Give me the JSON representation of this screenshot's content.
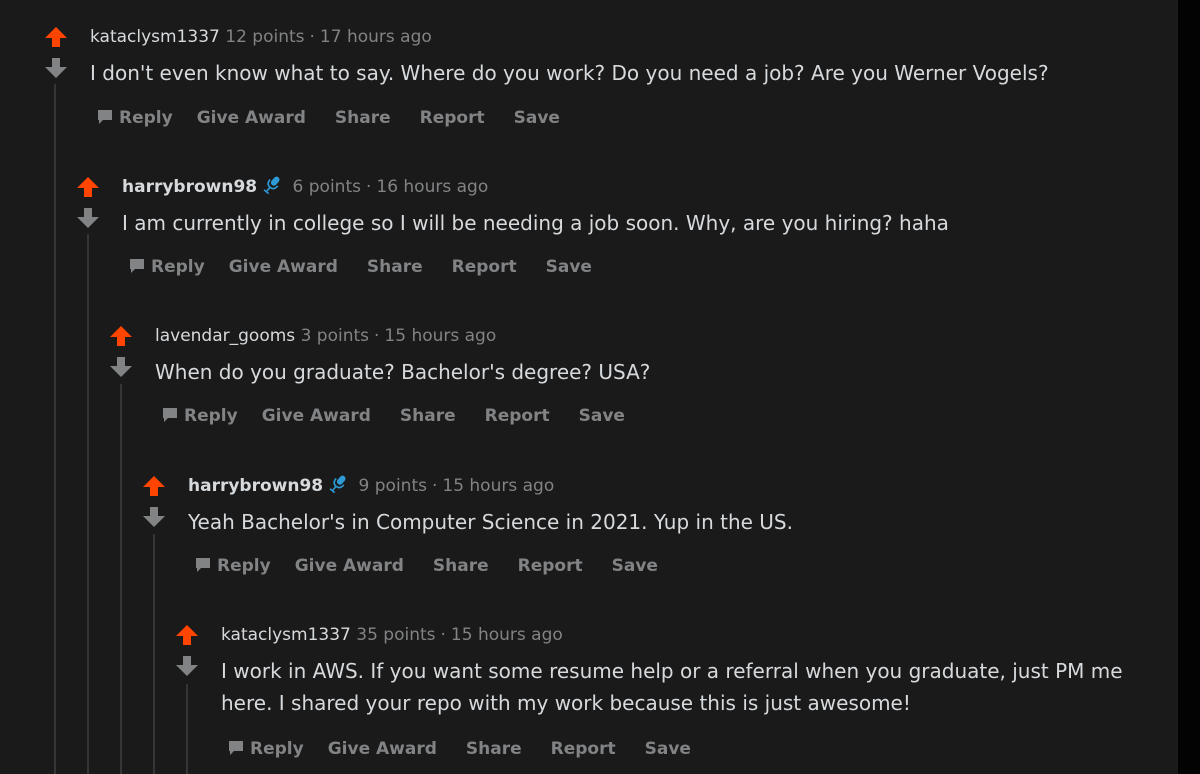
{
  "colors": {
    "background": "#1a1a1b",
    "upvote": "#ff4500",
    "downvote": "#818384",
    "text": "#d7dadc",
    "muted": "#818384",
    "thread_line": "#343536",
    "flair": "#2f9bd6"
  },
  "actions": {
    "reply": "Reply",
    "give_award": "Give Award",
    "share": "Share",
    "report": "Report",
    "save": "Save"
  },
  "separator": "·",
  "comments": [
    {
      "author": "kataclysm1337",
      "points": "12 points",
      "time": "17 hours ago",
      "body": "I don't even know what to say. Where do you work? Do you need a job? Are you Werner Vogels?"
    },
    {
      "author": "harrybrown98",
      "flair_icon": "microphone-icon",
      "points": "6 points",
      "time": "16 hours ago",
      "body": "I am currently in college so I will be needing a job soon. Why, are you hiring? haha"
    },
    {
      "author": "lavendar_gooms",
      "points": "3 points",
      "time": "15 hours ago",
      "body": "When do you graduate? Bachelor's degree? USA?"
    },
    {
      "author": "harrybrown98",
      "flair_icon": "microphone-icon",
      "points": "9 points",
      "time": "15 hours ago",
      "body": "Yeah Bachelor's in Computer Science in 2021. Yup in the US."
    },
    {
      "author": "kataclysm1337",
      "points": "35 points",
      "time": "15 hours ago",
      "body": "I work in AWS. If you want some resume help or a referral when you graduate, just PM me here. I shared your repo with my work because this is just awesome!"
    }
  ]
}
